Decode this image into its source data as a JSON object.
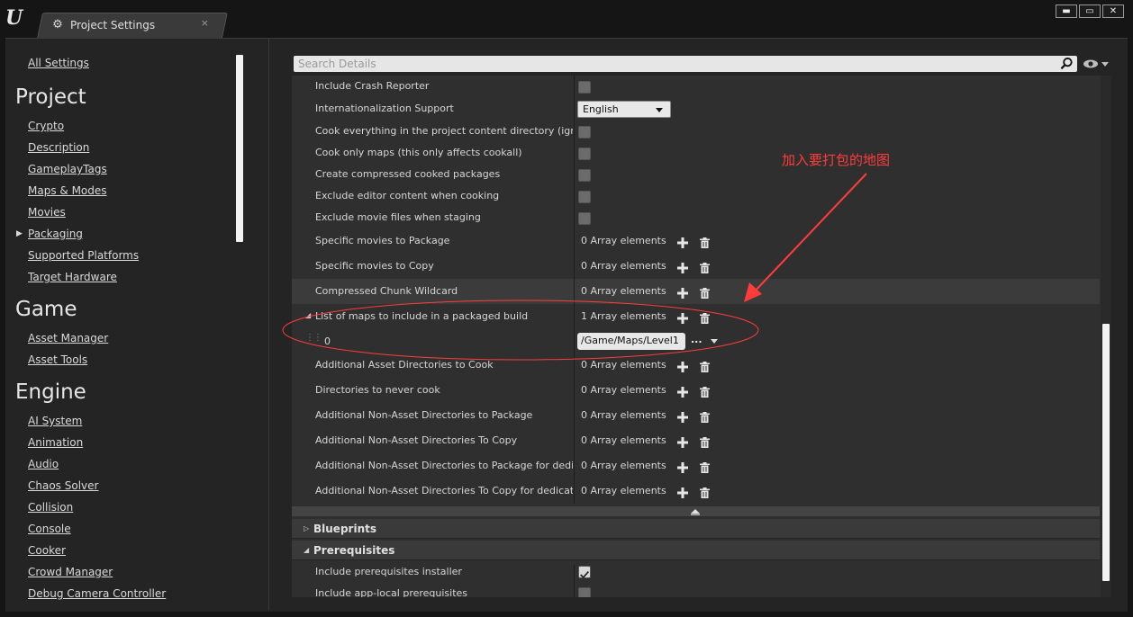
{
  "window": {
    "tab_title": "Project Settings",
    "tab_close": "×",
    "controls": [
      "▬",
      "▭",
      "✕"
    ]
  },
  "sidebar": {
    "all_settings": "All Settings",
    "sections": [
      {
        "title": "Project",
        "items": [
          "Crypto",
          "Description",
          "GameplayTags",
          "Maps & Modes",
          "Movies",
          "Packaging",
          "Supported Platforms",
          "Target Hardware"
        ]
      },
      {
        "title": "Game",
        "items": [
          "Asset Manager",
          "Asset Tools"
        ]
      },
      {
        "title": "Engine",
        "items": [
          "AI System",
          "Animation",
          "Audio",
          "Chaos Solver",
          "Collision",
          "Console",
          "Cooker",
          "Crowd Manager",
          "Debug Camera Controller"
        ]
      }
    ],
    "selected": "Packaging"
  },
  "search": {
    "placeholder": "Search Details"
  },
  "rows": [
    {
      "label": "Include Crash Reporter",
      "type": "checkbox",
      "checked": false
    },
    {
      "label": "Internationalization Support",
      "type": "dropdown",
      "value": "English"
    },
    {
      "label": "Cook everything in the project content directory (ignore li",
      "type": "checkbox",
      "checked": false
    },
    {
      "label": "Cook only maps (this only affects cookall)",
      "type": "checkbox",
      "checked": false
    },
    {
      "label": "Create compressed cooked packages",
      "type": "checkbox",
      "checked": false
    },
    {
      "label": "Exclude editor content when cooking",
      "type": "checkbox",
      "checked": false
    },
    {
      "label": "Exclude movie files when staging",
      "type": "checkbox",
      "checked": false
    },
    {
      "label": "Specific movies to Package",
      "type": "array",
      "value": "0 Array elements"
    },
    {
      "label": "Specific movies to Copy",
      "type": "array",
      "value": "0 Array elements"
    },
    {
      "label": "Compressed Chunk Wildcard",
      "type": "array",
      "value": "0 Array elements"
    },
    {
      "label": "List of maps to include in a packaged build",
      "type": "array",
      "value": "1 Array elements"
    },
    {
      "label": "0",
      "type": "asset",
      "value": "/Game/Maps/Level1",
      "dots": "..."
    },
    {
      "label": "Additional Asset Directories to Cook",
      "type": "array",
      "value": "0 Array elements"
    },
    {
      "label": "Directories to never cook",
      "type": "array",
      "value": "0 Array elements"
    },
    {
      "label": "Additional Non-Asset Directories to Package",
      "type": "array",
      "value": "0 Array elements"
    },
    {
      "label": "Additional Non-Asset Directories To Copy",
      "type": "array",
      "value": "0 Array elements"
    },
    {
      "label": "Additional Non-Asset Directories to Package for dedicate",
      "type": "array",
      "value": "0 Array elements"
    },
    {
      "label": "Additional Non-Asset Directories To Copy for dedicated s",
      "type": "array",
      "value": "0 Array elements"
    }
  ],
  "sections": {
    "blueprints": "Blueprints",
    "prerequisites": "Prerequisites"
  },
  "prereq_rows": [
    {
      "label": "Include prerequisites installer",
      "checked": true
    },
    {
      "label": "Include app-local prerequisites",
      "checked": false
    }
  ],
  "annotation": {
    "text": "加入要打包的地图",
    "color": "#ff3c3c"
  }
}
